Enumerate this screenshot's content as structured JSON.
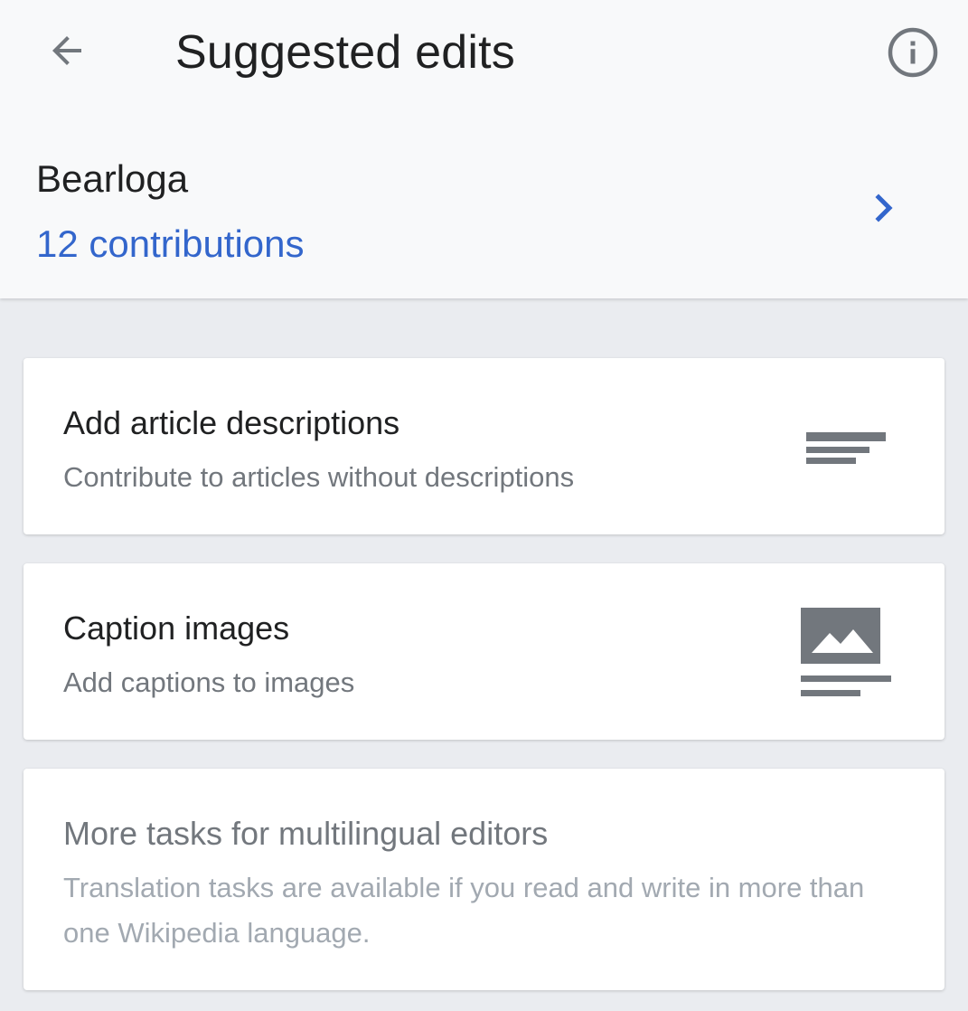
{
  "header": {
    "title": "Suggested edits",
    "back_icon": "arrow-back-icon",
    "info_icon": "info-icon"
  },
  "user": {
    "name": "Bearloga",
    "contributions": "12 contributions",
    "chevron_icon": "chevron-right-icon"
  },
  "tasks": [
    {
      "title": "Add article descriptions",
      "subtitle": "Contribute to articles without descriptions",
      "icon": "text-lines-icon",
      "enabled": true
    },
    {
      "title": "Caption images",
      "subtitle": "Add captions to images",
      "icon": "image-caption-icon",
      "enabled": true
    },
    {
      "title": "More tasks for multilingual editors",
      "subtitle": "Translation tasks are available if you read and write in more than one Wikipedia language.",
      "enabled": false
    }
  ],
  "colors": {
    "link": "#3366cc",
    "text": "#202122",
    "muted": "#72777d",
    "disabled": "#a2a9b1",
    "icon": "#72777d",
    "header_bg": "#f8f9fa",
    "page_bg": "#eaecf0"
  }
}
